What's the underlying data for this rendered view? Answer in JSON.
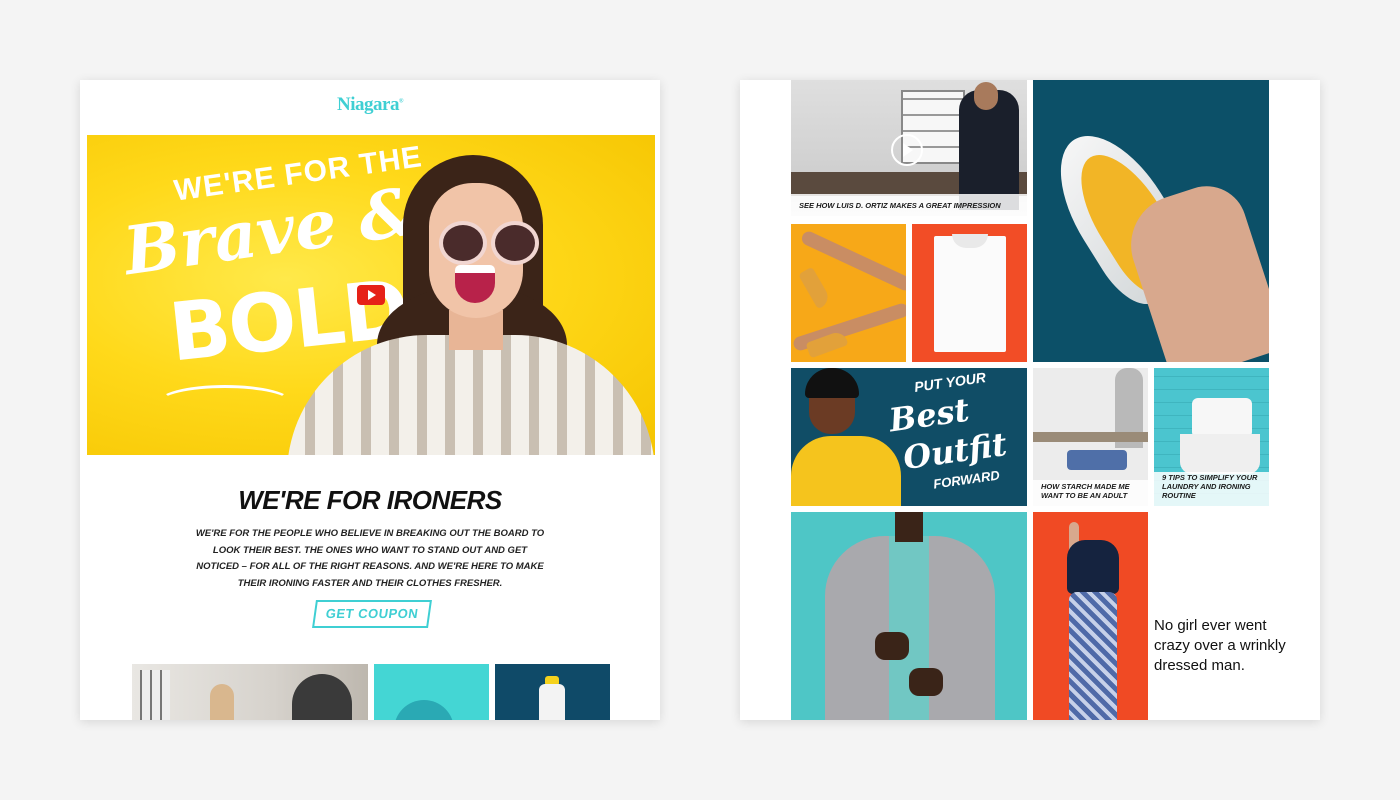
{
  "left": {
    "logo": "Niagara",
    "hero": {
      "line1": "WE'RE FOR THE",
      "line2": "Brave &",
      "line3": "BOLD"
    },
    "section_title": "WE'RE FOR IRONERS",
    "body": "We're for the people who believe in breaking out the board to look their best. The ones who want to stand out and get noticed – for all of the right reasons. And we're here to make their ironing faster and their clothes fresher.",
    "cta": "GET COUPON"
  },
  "right": {
    "tiles": {
      "ortiz_caption": "SEE HOW LUIS D. ORTIZ MAKES A GREAT IMPRESSION",
      "outfit": {
        "line1": "PUT YOUR",
        "line2": "Best",
        "line3": "Outfit",
        "line4": "FORWARD"
      },
      "starch_caption": "HOW STARCH MADE ME WANT TO BE AN ADULT",
      "tips_caption": "9 TIPS TO SIMPLIFY YOUR LAUNDRY AND IRONING ROUTINE"
    },
    "quote": "No girl ever went crazy over a wrinkly dressed man."
  },
  "colors": {
    "brand_teal": "#3fcfd3",
    "hero_yellow": "#ffd91a",
    "navy": "#0c5068",
    "orange_red": "#f24d26",
    "amber": "#f7a818"
  },
  "icons": [
    "youtube-play-icon",
    "video-play-icon"
  ]
}
